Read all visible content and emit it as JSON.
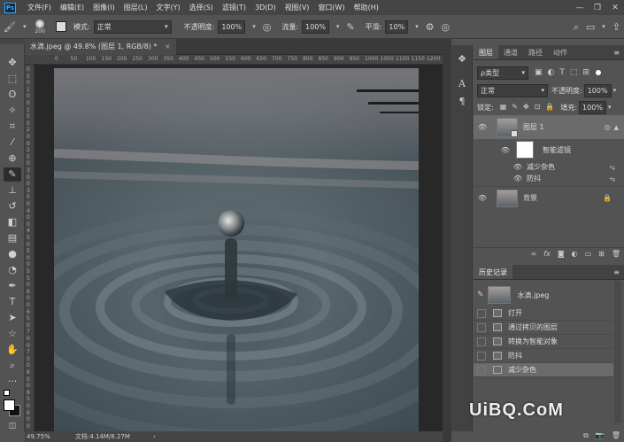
{
  "menu": {
    "logo": "Ps",
    "items": [
      "文件(F)",
      "编辑(E)",
      "图像(I)",
      "图层(L)",
      "文字(Y)",
      "选择(S)",
      "滤镜(T)",
      "3D(D)",
      "视图(V)",
      "窗口(W)",
      "帮助(H)"
    ],
    "window_controls": [
      "—",
      "❐",
      "✕"
    ]
  },
  "options": {
    "brush_size": "200",
    "mode_label": "模式:",
    "mode_value": "正常",
    "opacity_label": "不透明度:",
    "opacity_value": "100%",
    "flow_label": "流量:",
    "flow_value": "100%",
    "smooth_label": "平滑:",
    "smooth_value": "10%"
  },
  "document": {
    "tab_title": "水滴.jpeg @ 49.8% (图层 1, RGB/8) *",
    "close": "×"
  },
  "ruler": {
    "h_ticks": [
      "0",
      "50",
      "100",
      "150",
      "200",
      "250",
      "300",
      "350",
      "400",
      "450",
      "500",
      "550",
      "600",
      "650",
      "700",
      "750",
      "800",
      "850",
      "900",
      "950",
      "1000",
      "1050",
      "1100",
      "1150",
      "1200"
    ],
    "v_ticks": [
      "0",
      "5",
      "0",
      "1",
      "0",
      "0",
      "1",
      "5",
      "0",
      "2",
      "0",
      "0",
      "2",
      "5",
      "0",
      "3",
      "0",
      "0",
      "3",
      "5",
      "0",
      "4",
      "0",
      "0",
      "4",
      "5",
      "0",
      "5",
      "0",
      "0",
      "5",
      "5",
      "0",
      "6",
      "0",
      "0",
      "6",
      "5",
      "0",
      "7",
      "0",
      "0",
      "7",
      "5",
      "0",
      "8",
      "0",
      "0",
      "8",
      "5",
      "0",
      "9",
      "0",
      "0"
    ]
  },
  "status": {
    "zoom": "49.75%",
    "doc": "文档:4.14M/8.27M",
    "arrow": "›"
  },
  "layers_panel": {
    "tabs": [
      "图层",
      "通道",
      "路径",
      "动作"
    ],
    "kind_label": "ρ类型",
    "blend_mode": "正常",
    "opacity_label": "不透明度:",
    "opacity_value": "100%",
    "lock_label": "锁定:",
    "fill_label": "填充:",
    "fill_value": "100%",
    "layers": [
      {
        "name": "图层 1"
      },
      {
        "name": "智能滤镜"
      },
      {
        "name": "减少杂色"
      },
      {
        "name": "防抖"
      },
      {
        "name": "背景"
      }
    ]
  },
  "history_panel": {
    "tab": "历史记录",
    "source": "水滴.jpeg",
    "items": [
      "打开",
      "通过拷贝的图层",
      "转换为智能对象",
      "防抖",
      "减少杂色"
    ]
  },
  "watermark": "UiBQ.CoM"
}
